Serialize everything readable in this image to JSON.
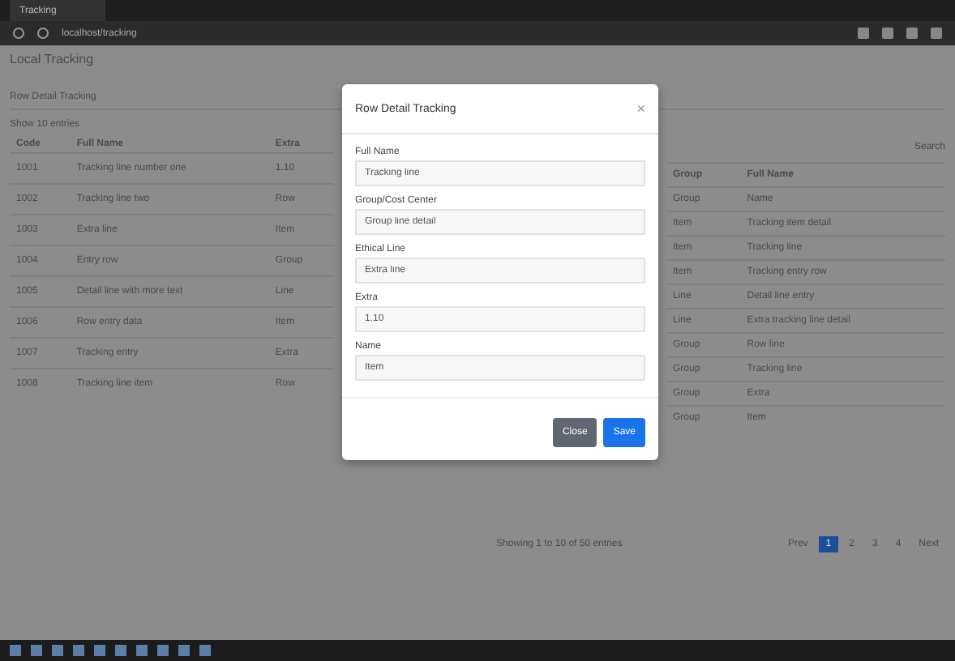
{
  "browser": {
    "tab_title": "Tracking",
    "address": "localhost/tracking"
  },
  "page": {
    "title": "Local Tracking",
    "subtitle": "Row Detail Tracking",
    "filter": "Show 10 entries",
    "right_header": "Search"
  },
  "left_table": {
    "columns": [
      "Code",
      "Full Name",
      "Extra"
    ],
    "rows": [
      {
        "cells": [
          "1001",
          "Tracking line number one",
          "1.10"
        ]
      },
      {
        "cells": [
          "1002",
          "Tracking line two",
          "Row"
        ]
      },
      {
        "cells": [
          "1003",
          "Extra line",
          "Item"
        ]
      },
      {
        "cells": [
          "1004",
          "Entry row",
          "Group"
        ]
      },
      {
        "cells": [
          "1005",
          "Detail line with more text",
          "Line"
        ]
      },
      {
        "cells": [
          "1006",
          "Row entry data",
          "Item"
        ]
      },
      {
        "cells": [
          "1007",
          "Tracking entry",
          "Extra"
        ]
      },
      {
        "cells": [
          "1008",
          "Tracking line item",
          "Row"
        ]
      }
    ]
  },
  "right_table": {
    "columns": [
      "Group",
      "Full Name"
    ],
    "rows": [
      {
        "cells": [
          "Group",
          "Name"
        ]
      },
      {
        "cells": [
          "Item",
          "Tracking item detail"
        ]
      },
      {
        "cells": [
          "Item",
          "Tracking line"
        ]
      },
      {
        "cells": [
          "Item",
          "Tracking entry row"
        ]
      },
      {
        "cells": [
          "Line",
          "Detail line entry"
        ]
      },
      {
        "cells": [
          "Line",
          "Extra tracking line detail"
        ]
      },
      {
        "cells": [
          "Group",
          "Row line"
        ]
      },
      {
        "cells": [
          "Group",
          "Tracking line"
        ]
      },
      {
        "cells": [
          "Group",
          "Extra"
        ]
      },
      {
        "cells": [
          "Group",
          "Item"
        ]
      }
    ]
  },
  "info": "Showing 1 to 10 of 50 entries",
  "pagination": [
    {
      "label": "Prev",
      "selected": false
    },
    {
      "label": "1",
      "selected": true
    },
    {
      "label": "2",
      "selected": false
    },
    {
      "label": "3",
      "selected": false
    },
    {
      "label": "4",
      "selected": false
    },
    {
      "label": "Next",
      "selected": false
    }
  ],
  "modal": {
    "title": "Row Detail Tracking",
    "close": "×",
    "fields": [
      {
        "label": "Full Name",
        "value": "Tracking line"
      },
      {
        "label": "Group/Cost Center",
        "value": "Group line detail"
      },
      {
        "label": "Ethical Line",
        "value": "Extra line"
      },
      {
        "label": "Extra",
        "value": "1.10"
      },
      {
        "label": "Name",
        "value": "Item"
      }
    ],
    "buttons": [
      {
        "label": "Close",
        "kind": "secondary"
      },
      {
        "label": "Save",
        "kind": "primary"
      }
    ]
  }
}
